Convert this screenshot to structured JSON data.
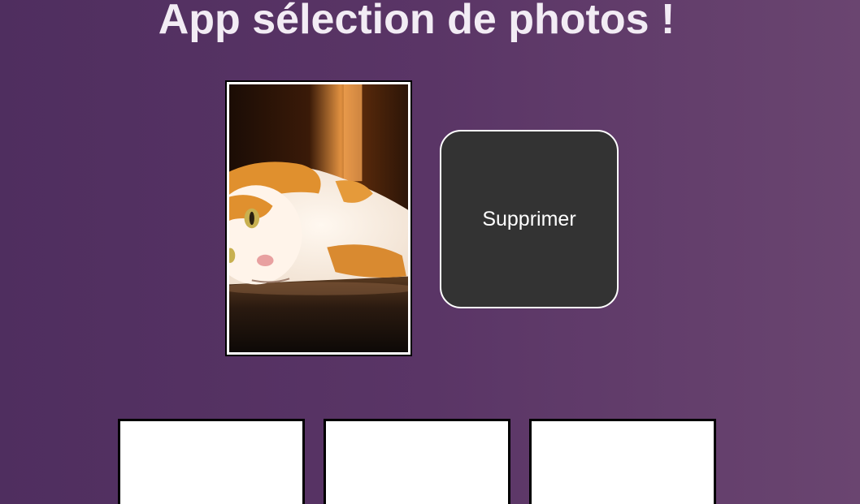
{
  "header": {
    "title": "App sélection de photos !"
  },
  "selected_photo": {
    "subject": "orange-and-white-cat-lying-on-floor"
  },
  "actions": {
    "delete_label": "Supprimer"
  },
  "thumbnails": [
    {
      "state": "empty"
    },
    {
      "state": "empty"
    },
    {
      "state": "empty"
    }
  ],
  "colors": {
    "background_left": "#4f2e5f",
    "background_right": "#6a4570",
    "button_bg": "#333333",
    "title_text": "#f2ecf4"
  }
}
